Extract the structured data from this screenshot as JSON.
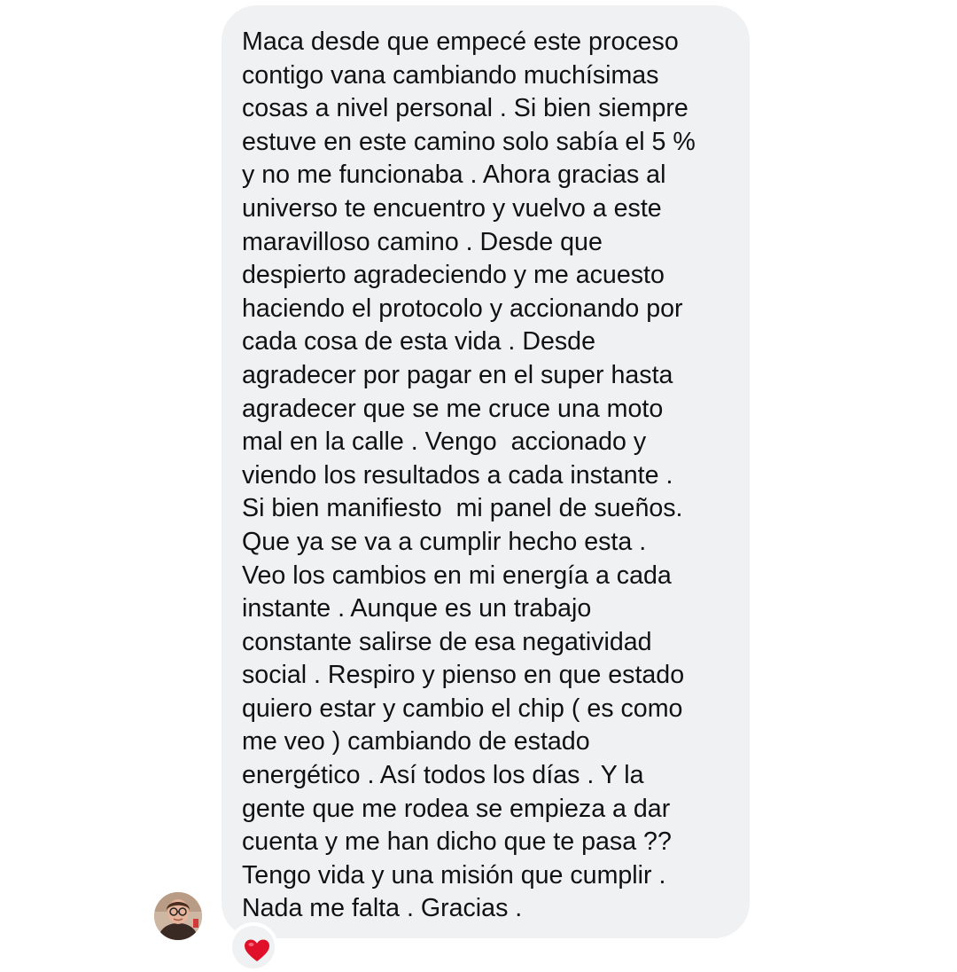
{
  "message": {
    "lines": [
      "Maca desde que empecé este proceso",
      "contigo vana cambiando muchísimas",
      "cosas a nivel personal . Si bien siempre",
      "estuve en este camino solo sabía el 5 %",
      "y no me funcionaba . Ahora gracias al",
      "universo te encuentro y vuelvo a este",
      "maravilloso camino . Desde que",
      "despierto agradeciendo y me acuesto",
      "haciendo el protocolo y accionando por",
      "cada cosa de esta vida . Desde",
      "agradecer por pagar en el super hasta",
      "agradecer que se me cruce una moto",
      "mal en la calle . Vengo  accionado y",
      "viendo los resultados a cada instante .",
      "Si bien manifiesto  mi panel de sueños.",
      "Que ya se va a cumplir hecho esta .",
      "Veo los cambios en mi energía a cada",
      "instante . Aunque es un trabajo",
      "constante salirse de esa negatividad",
      "social . Respiro y pienso en que estado",
      "quiero estar y cambio el chip ( es como",
      "me veo ) cambiando de estado",
      "energético . Así todos los días . Y la",
      "gente que me rodea se empieza a dar",
      "cuenta y me han dicho que te pasa ??",
      "Tengo vida y una misión que cumplir .",
      "Nada me falta . Gracias ."
    ],
    "bubble_color": "#f0f1f3",
    "text_color": "#111111"
  },
  "sender": {
    "avatar_icon": "avatar"
  },
  "reaction": {
    "icon": "heart-icon",
    "color": "#e0102a"
  }
}
